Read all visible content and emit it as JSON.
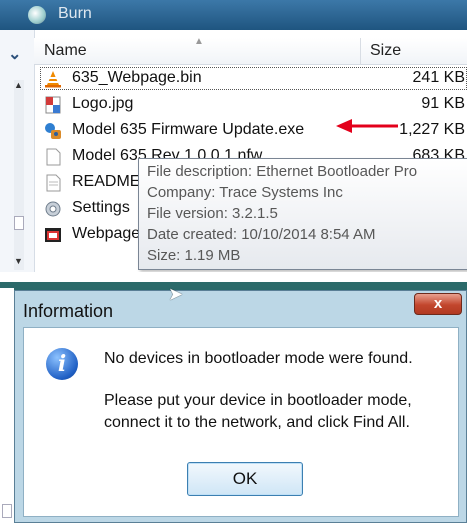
{
  "explorer": {
    "folder_title": "Burn",
    "columns": {
      "name": "Name",
      "size": "Size"
    },
    "files": [
      {
        "name": "635_Webpage.bin",
        "size": "241 KB",
        "icon": "vlc-cone-icon"
      },
      {
        "name": "Logo.jpg",
        "size": "91 KB",
        "icon": "image-file-icon"
      },
      {
        "name": "Model 635 Firmware Update.exe",
        "size": "1,227 KB",
        "icon": "installer-exe-icon"
      },
      {
        "name": "Model 635 Rev 1.0.0.1.nfw",
        "size": "683 KB",
        "icon": "blank-file-icon"
      },
      {
        "name": "README",
        "size": "",
        "icon": "text-file-icon"
      },
      {
        "name": "Settings",
        "size": "",
        "icon": "settings-file-icon"
      },
      {
        "name": "Webpage",
        "size": "",
        "icon": "webpage-file-icon"
      }
    ],
    "tooltip": {
      "description": "File description: Ethernet Bootloader Pro",
      "company": "Company: Trace Systems Inc",
      "version": "File version: 3.2.1.5",
      "created": "Date created: 10/10/2014 8:54 AM",
      "size": "Size: 1.19 MB"
    },
    "annotation_color": "#e3001b"
  },
  "dialog": {
    "title": "Information",
    "close_label": "x",
    "message_1": "No devices in bootloader mode were found.",
    "message_2": "Please put your device in bootloader mode,",
    "message_3": "connect it to the network, and click Find All.",
    "ok_label": "OK",
    "icon": "info-icon"
  }
}
